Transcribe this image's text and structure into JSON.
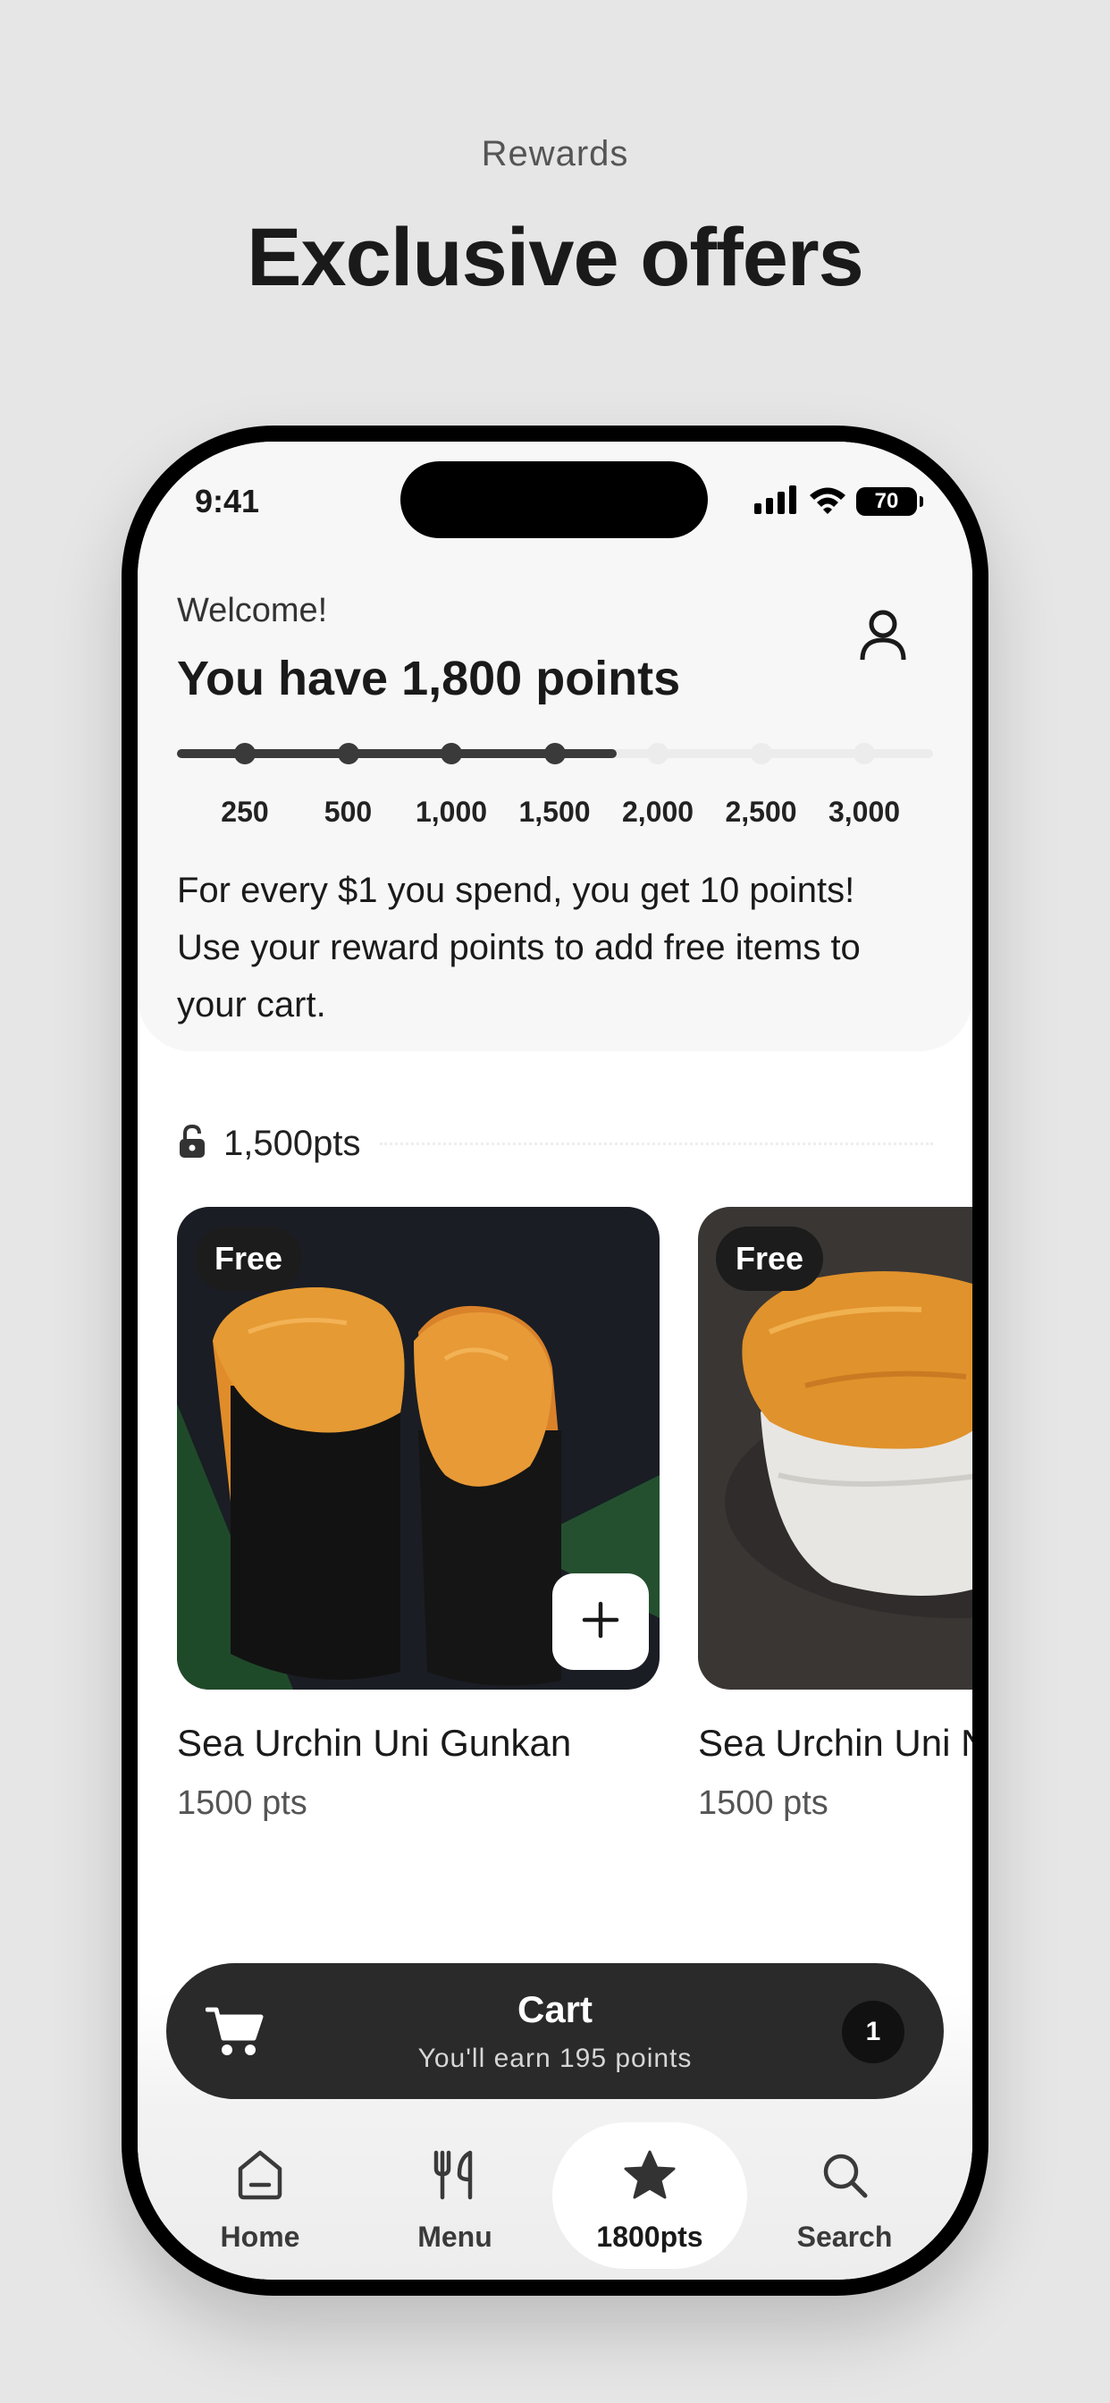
{
  "promo": {
    "subtitle": "Rewards",
    "title": "Exclusive offers"
  },
  "status_bar": {
    "time": "9:41",
    "battery": "70"
  },
  "rewards": {
    "welcome": "Welcome!",
    "headline": "You have 1,800 points",
    "points": 1800,
    "max_points": 3000,
    "milestones": [
      {
        "label": "250",
        "value": 250,
        "reached": true
      },
      {
        "label": "500",
        "value": 500,
        "reached": true
      },
      {
        "label": "1,000",
        "value": 1000,
        "reached": true
      },
      {
        "label": "1,500",
        "value": 1500,
        "reached": true
      },
      {
        "label": "2,000",
        "value": 2000,
        "reached": false
      },
      {
        "label": "2,500",
        "value": 2500,
        "reached": false
      },
      {
        "label": "3,000",
        "value": 3000,
        "reached": false
      }
    ],
    "info": "For every $1 you spend, you get 10 points! Use your reward points to add free items to your cart."
  },
  "tier": {
    "label": "1,500pts",
    "icon": "unlock-icon"
  },
  "items": [
    {
      "badge": "Free",
      "name": "Sea Urchin Uni Gunkan",
      "points": "1500 pts"
    },
    {
      "badge": "Free",
      "name": "Sea Urchin Uni Nigiri",
      "points": "1500 pts"
    }
  ],
  "cart": {
    "title": "Cart",
    "subtitle": "You'll earn 195 points",
    "count": "1"
  },
  "tabs": [
    {
      "label": "Home",
      "icon": "home-icon",
      "active": false
    },
    {
      "label": "Menu",
      "icon": "utensils-icon",
      "active": false
    },
    {
      "label": "1800pts",
      "icon": "star-icon",
      "active": true
    },
    {
      "label": "Search",
      "icon": "search-icon",
      "active": false
    }
  ],
  "colors": {
    "background": "#e6e6e6",
    "dark": "#2a2a2a",
    "progress_fill": "#3a3a3a",
    "progress_empty": "#ececec"
  }
}
